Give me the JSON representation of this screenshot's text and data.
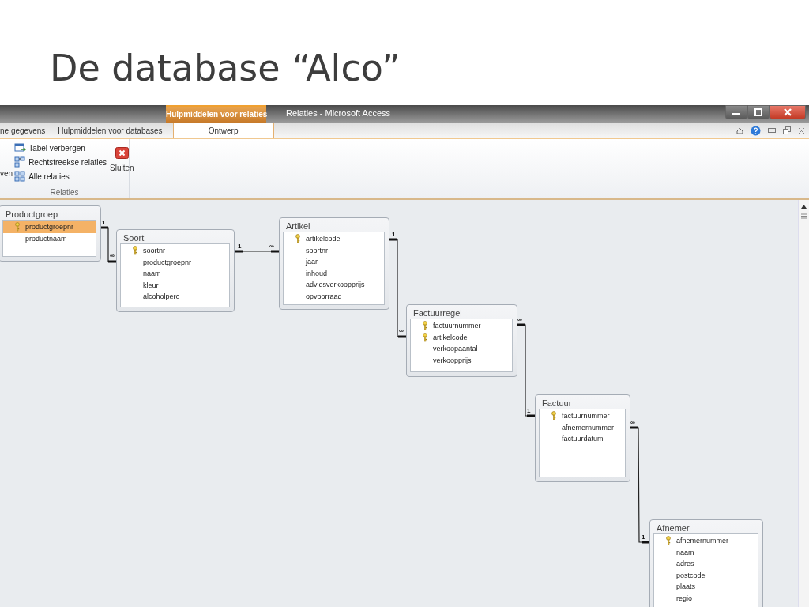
{
  "slide": {
    "title": "De database “Alco”"
  },
  "window": {
    "contextual_tab": "Hulpmiddelen voor relaties",
    "title": "Relaties - Microsoft Access"
  },
  "tabs": [
    {
      "label": "ne gegevens",
      "selected": false
    },
    {
      "label": "Hulpmiddelen voor databases",
      "selected": false
    },
    {
      "label": "Ontwerp",
      "selected": true
    }
  ],
  "ribbon": {
    "cut_label": "ven",
    "items": [
      {
        "label": "Tabel verbergen",
        "kind": "hide"
      },
      {
        "label": "Rechtstreekse relaties",
        "kind": "direct"
      },
      {
        "label": "Alle relaties",
        "kind": "all"
      }
    ],
    "close_button": "Sluiten",
    "group_label": "Relaties"
  },
  "tables": [
    {
      "title": "Productgroep",
      "fields": [
        {
          "name": "productgroepnr",
          "primary_key": true,
          "selected": true
        },
        {
          "name": "productnaam",
          "primary_key": false,
          "selected": false
        }
      ]
    },
    {
      "title": "Soort",
      "fields": [
        {
          "name": "soortnr",
          "primary_key": true,
          "selected": false
        },
        {
          "name": "productgroepnr",
          "primary_key": false,
          "selected": false
        },
        {
          "name": "naam",
          "primary_key": false,
          "selected": false
        },
        {
          "name": "kleur",
          "primary_key": false,
          "selected": false
        },
        {
          "name": "alcoholperc",
          "primary_key": false,
          "selected": false
        }
      ]
    },
    {
      "title": "Artikel",
      "fields": [
        {
          "name": "artikelcode",
          "primary_key": true,
          "selected": false
        },
        {
          "name": "soortnr",
          "primary_key": false,
          "selected": false
        },
        {
          "name": "jaar",
          "primary_key": false,
          "selected": false
        },
        {
          "name": "inhoud",
          "primary_key": false,
          "selected": false
        },
        {
          "name": "adviesverkoopprijs",
          "primary_key": false,
          "selected": false
        },
        {
          "name": "opvoorraad",
          "primary_key": false,
          "selected": false
        }
      ]
    },
    {
      "title": "Factuurregel",
      "fields": [
        {
          "name": "factuurnummer",
          "primary_key": true,
          "selected": false
        },
        {
          "name": "artikelcode",
          "primary_key": true,
          "selected": false
        },
        {
          "name": "verkoopaantal",
          "primary_key": false,
          "selected": false
        },
        {
          "name": "verkoopprijs",
          "primary_key": false,
          "selected": false
        }
      ]
    },
    {
      "title": "Factuur",
      "fields": [
        {
          "name": "factuurnummer",
          "primary_key": true,
          "selected": false
        },
        {
          "name": "afnemernummer",
          "primary_key": false,
          "selected": false
        },
        {
          "name": "factuurdatum",
          "primary_key": false,
          "selected": false
        }
      ]
    },
    {
      "title": "Afnemer",
      "fields": [
        {
          "name": "afnemernummer",
          "primary_key": true,
          "selected": false
        },
        {
          "name": "naam",
          "primary_key": false,
          "selected": false
        },
        {
          "name": "adres",
          "primary_key": false,
          "selected": false
        },
        {
          "name": "postcode",
          "primary_key": false,
          "selected": false
        },
        {
          "name": "plaats",
          "primary_key": false,
          "selected": false
        },
        {
          "name": "regio",
          "primary_key": false,
          "selected": false
        }
      ]
    }
  ],
  "relations": [
    {
      "start_label": "1",
      "end_label": "∞"
    },
    {
      "start_label": "1",
      "end_label": "∞"
    },
    {
      "start_label": "1",
      "end_label": "∞"
    },
    {
      "start_label": "∞",
      "end_label": "1"
    },
    {
      "start_label": "∞",
      "end_label": "1"
    }
  ]
}
